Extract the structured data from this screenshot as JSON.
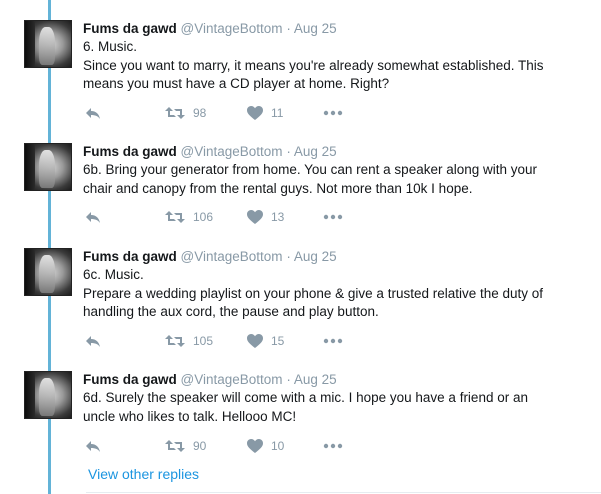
{
  "tweets": [
    {
      "name": "Fums da gawd",
      "handle": "@VintageBottom",
      "separator": "·",
      "date": "Aug 25",
      "lines": [
        "6. Music.",
        "Since you want to marry, it means you're already somewhat established. This",
        "means you must have a CD player at home. Right?"
      ],
      "retweets": "98",
      "likes": "11"
    },
    {
      "name": "Fums da gawd",
      "handle": "@VintageBottom",
      "separator": "·",
      "date": "Aug 25",
      "lines": [
        "6b. Bring your generator from home. You can rent a speaker along with your",
        "chair and canopy from the rental guys. Not more than 10k I hope."
      ],
      "retweets": "106",
      "likes": "13"
    },
    {
      "name": "Fums da gawd",
      "handle": "@VintageBottom",
      "separator": "·",
      "date": "Aug 25",
      "lines": [
        "6c. Music.",
        "Prepare a wedding playlist on your phone & give a trusted relative the duty of",
        "handling the aux cord, the pause and play button."
      ],
      "retweets": "105",
      "likes": "15"
    },
    {
      "name": "Fums da gawd",
      "handle": "@VintageBottom",
      "separator": "·",
      "date": "Aug 25",
      "lines": [
        "6d. Surely the speaker will come with a mic. I hope you have a friend or an",
        "uncle who likes to talk. Hellooo MC!"
      ],
      "retweets": "90",
      "likes": "10"
    }
  ],
  "view_other_replies": "View other replies",
  "icons": {
    "reply": "reply-icon",
    "retweet": "retweet-icon",
    "like": "heart-icon",
    "more": "more-dots-icon"
  },
  "colors": {
    "thread_line": "#63b3d7",
    "muted": "#8899a6",
    "link": "#1b95e0"
  }
}
